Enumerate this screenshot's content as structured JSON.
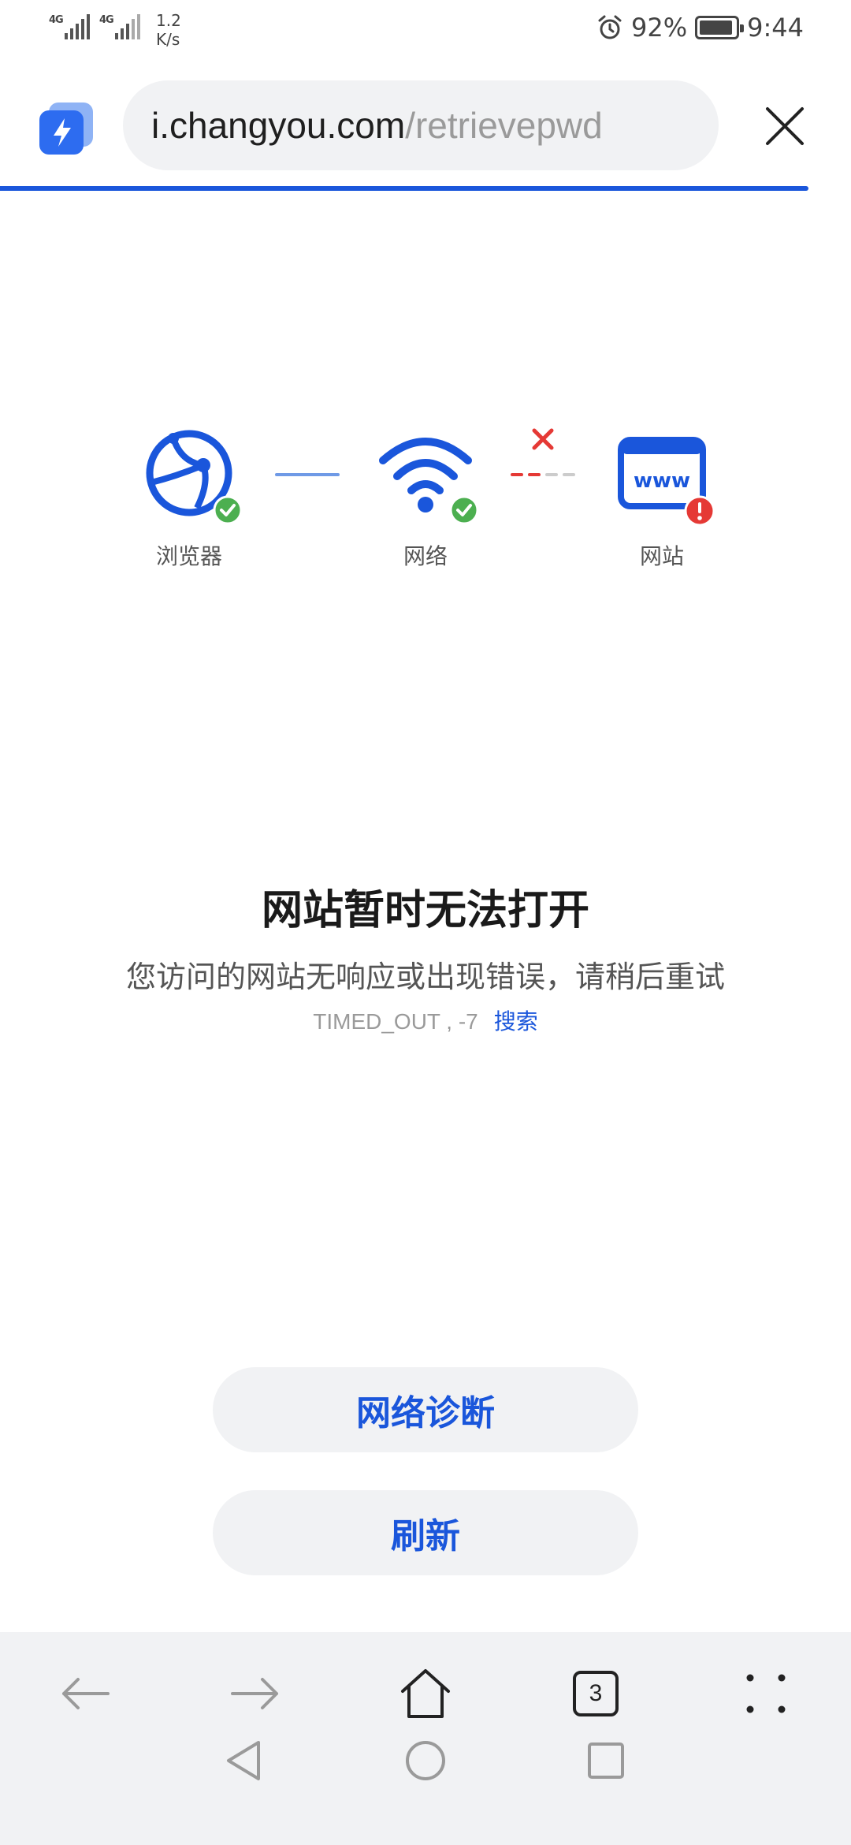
{
  "status_bar": {
    "network_1": "4G",
    "network_2": "4G",
    "speed_value": "1.2",
    "speed_unit": "K/s",
    "battery": "92%",
    "battery_level": 0.92,
    "time": "9:44"
  },
  "address_bar": {
    "url_host": "i.changyou.com",
    "url_path": "/retrievepwd"
  },
  "diagnostic": {
    "browser_label": "浏览器",
    "network_label": "网络",
    "website_label": "网站"
  },
  "error": {
    "title": "网站暂时无法打开",
    "description": "您访问的网站无响应或出现错误，请稍后重试",
    "code": "TIMED_OUT , -7",
    "search_link": "搜索"
  },
  "buttons": {
    "network_diagnosis": "网络诊断",
    "refresh": "刷新"
  },
  "toolbar": {
    "tab_count": "3"
  },
  "colors": {
    "accent": "#1a56db",
    "ok": "#4caf50",
    "error": "#e53935"
  }
}
